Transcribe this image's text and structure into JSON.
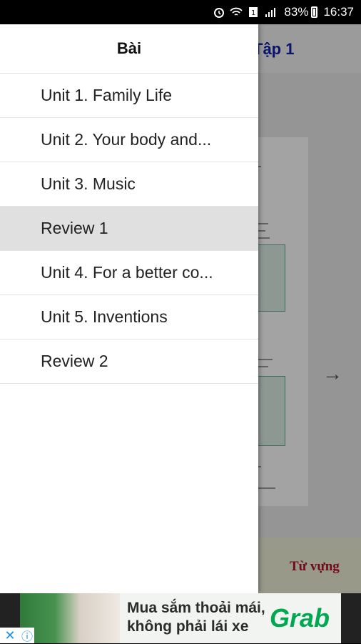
{
  "status_bar": {
    "battery": "83%",
    "time": "16:37"
  },
  "background": {
    "header_title": "Tập 1",
    "footer_link": "Từ vựng",
    "next_arrow": "→"
  },
  "drawer": {
    "title": "Bài",
    "items": [
      {
        "label": "Unit 1. Family Life",
        "selected": false
      },
      {
        "label": "Unit 2. Your body and...",
        "selected": false
      },
      {
        "label": "Unit 3. Music",
        "selected": false
      },
      {
        "label": "Review 1",
        "selected": true
      },
      {
        "label": "Unit 4. For a better co...",
        "selected": false
      },
      {
        "label": "Unit 5. Inventions",
        "selected": false
      },
      {
        "label": "Review 2",
        "selected": false
      }
    ]
  },
  "ad": {
    "line1": "Mua sắm thoải mái,",
    "line2": "không phải lái xe",
    "brand": "Grab",
    "close_icon": "✕",
    "info_icon": "ⓘ"
  },
  "colors": {
    "selected_item_bg": "#e0e0e0",
    "header_title": "#1020a8",
    "footer_link": "#b0102a",
    "brand": "#00a850"
  }
}
